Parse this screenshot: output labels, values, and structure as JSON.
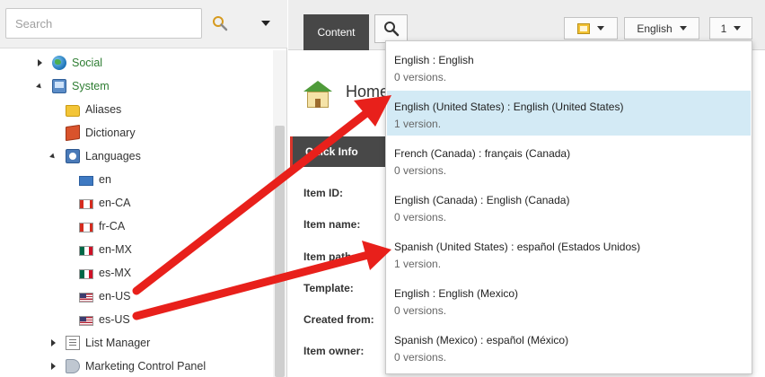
{
  "search": {
    "placeholder": "Search"
  },
  "tree": {
    "items": [
      {
        "label": "Social",
        "icon": "globe-icon",
        "style": "green"
      },
      {
        "label": "System",
        "icon": "system-icon",
        "style": "green"
      },
      {
        "label": "Aliases",
        "icon": "folder-icon"
      },
      {
        "label": "Dictionary",
        "icon": "book-icon"
      },
      {
        "label": "Languages",
        "icon": "languages-icon"
      },
      {
        "label": "en",
        "icon": "globe-flag-icon"
      },
      {
        "label": "en-CA",
        "icon": "canada-flag-icon"
      },
      {
        "label": "fr-CA",
        "icon": "canada-flag-icon"
      },
      {
        "label": "en-MX",
        "icon": "mexico-flag-icon"
      },
      {
        "label": "es-MX",
        "icon": "mexico-flag-icon"
      },
      {
        "label": "en-US",
        "icon": "us-flag-icon"
      },
      {
        "label": "es-US",
        "icon": "us-flag-icon"
      },
      {
        "label": "List Manager",
        "icon": "list-icon"
      },
      {
        "label": "Marketing Control Panel",
        "icon": "megaphone-icon"
      }
    ]
  },
  "toolbar": {
    "content_tab": "Content",
    "language": "English",
    "version": "1"
  },
  "item": {
    "title": "Home",
    "quick_info": "Quick Info",
    "fields": [
      "Item ID:",
      "Item name:",
      "Item path:",
      "Template:",
      "Created from:",
      "Item owner:"
    ]
  },
  "versions": {
    "options": [
      {
        "title": "English : English",
        "sub": "0 versions."
      },
      {
        "title": "English (United States) : English (United States)",
        "sub": "1 version.",
        "selected": true
      },
      {
        "title": "French (Canada) : français (Canada)",
        "sub": "0 versions."
      },
      {
        "title": "English (Canada) : English (Canada)",
        "sub": "0 versions."
      },
      {
        "title": "Spanish (United States) : español (Estados Unidos)",
        "sub": "1 version."
      },
      {
        "title": "English : English (Mexico)",
        "sub": "0 versions."
      },
      {
        "title": "Spanish (Mexico) : español (México)",
        "sub": "0 versions."
      }
    ]
  },
  "colors": {
    "arrow": "#e8201b",
    "selected_bg": "#d3eaf5",
    "tab_dark": "#474747",
    "accent_red": "#d8352a"
  }
}
